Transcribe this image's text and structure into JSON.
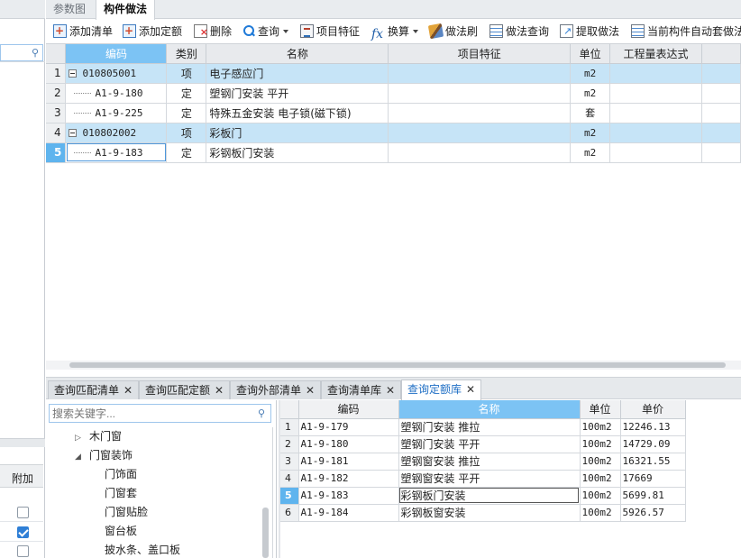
{
  "top_tabs": [
    {
      "label": "参数图",
      "active": false
    },
    {
      "label": "构件做法",
      "active": true
    }
  ],
  "toolbar": {
    "add_list": "添加清单",
    "add_quota": "添加定额",
    "delete": "删除",
    "query": "查询",
    "item_feature": "项目特征",
    "convert": "换算",
    "method_brush": "做法刷",
    "method_query": "做法查询",
    "extract_method": "提取做法",
    "auto_apply": "当前构件自动套做法"
  },
  "upper_grid": {
    "columns": [
      "编码",
      "类别",
      "名称",
      "项目特征",
      "单位",
      "工程量表达式"
    ],
    "rows": [
      {
        "num": "1",
        "code": "010805001",
        "type": "项",
        "name": "电子感应门",
        "feature": "",
        "unit": "m2",
        "expr": "",
        "level": 0,
        "highlight": true
      },
      {
        "num": "2",
        "code": "A1-9-180",
        "type": "定",
        "name": "塑钢门安装 平开",
        "feature": "",
        "unit": "m2",
        "expr": "",
        "level": 1,
        "highlight": false
      },
      {
        "num": "3",
        "code": "A1-9-225",
        "type": "定",
        "name": "特殊五金安装 电子锁(磁下锁)",
        "feature": "",
        "unit": "套",
        "expr": "",
        "level": 1,
        "highlight": false
      },
      {
        "num": "4",
        "code": "010802002",
        "type": "项",
        "name": "彩板门",
        "feature": "",
        "unit": "m2",
        "expr": "",
        "level": 0,
        "highlight": true
      },
      {
        "num": "5",
        "code": "A1-9-183",
        "type": "定",
        "name": "彩钢板门安装",
        "feature": "",
        "unit": "m2",
        "expr": "",
        "level": 1,
        "highlight": false,
        "current": true
      }
    ]
  },
  "bottom_tabs": [
    {
      "label": "查询匹配清单",
      "active": false
    },
    {
      "label": "查询匹配定额",
      "active": false
    },
    {
      "label": "查询外部清单",
      "active": false
    },
    {
      "label": "查询清单库",
      "active": false
    },
    {
      "label": "查询定额库",
      "active": true
    }
  ],
  "tree": {
    "search_placeholder": "搜索关键字...",
    "items": [
      {
        "label": "木门窗",
        "arrow": "▷",
        "level": 1
      },
      {
        "label": "门窗装饰",
        "arrow": "◢",
        "level": 1
      },
      {
        "label": "门饰面",
        "arrow": "",
        "level": 2
      },
      {
        "label": "门窗套",
        "arrow": "",
        "level": 2
      },
      {
        "label": "门窗贴脸",
        "arrow": "",
        "level": 2
      },
      {
        "label": "窗台板",
        "arrow": "",
        "level": 2
      },
      {
        "label": "披水条、盖口板",
        "arrow": "",
        "level": 2
      }
    ]
  },
  "lower_grid": {
    "columns": [
      "编码",
      "名称",
      "单位",
      "单价"
    ],
    "rows": [
      {
        "num": "1",
        "code": "A1-9-179",
        "name": "塑钢门安装 推拉",
        "unit": "100m2",
        "price": "12246.13"
      },
      {
        "num": "2",
        "code": "A1-9-180",
        "name": "塑钢门安装 平开",
        "unit": "100m2",
        "price": "14729.09"
      },
      {
        "num": "3",
        "code": "A1-9-181",
        "name": "塑钢窗安装 推拉",
        "unit": "100m2",
        "price": "16321.55"
      },
      {
        "num": "4",
        "code": "A1-9-182",
        "name": "塑钢窗安装 平开",
        "unit": "100m2",
        "price": "17669"
      },
      {
        "num": "5",
        "code": "A1-9-183",
        "name": "彩钢板门安装",
        "unit": "100m2",
        "price": "5699.81",
        "current": true
      },
      {
        "num": "6",
        "code": "A1-9-184",
        "name": "彩钢板窗安装",
        "unit": "100m2",
        "price": "5926.57"
      }
    ]
  },
  "left_panel": {
    "column_header": "附加",
    "checkboxes": [
      false,
      true,
      false
    ]
  },
  "colors": {
    "row_highlight": "#c6e4f7",
    "header_selected": "#7cc3f4",
    "current_row_number": "#5fb4ee",
    "active_tab_text": "#1f6fc5"
  }
}
